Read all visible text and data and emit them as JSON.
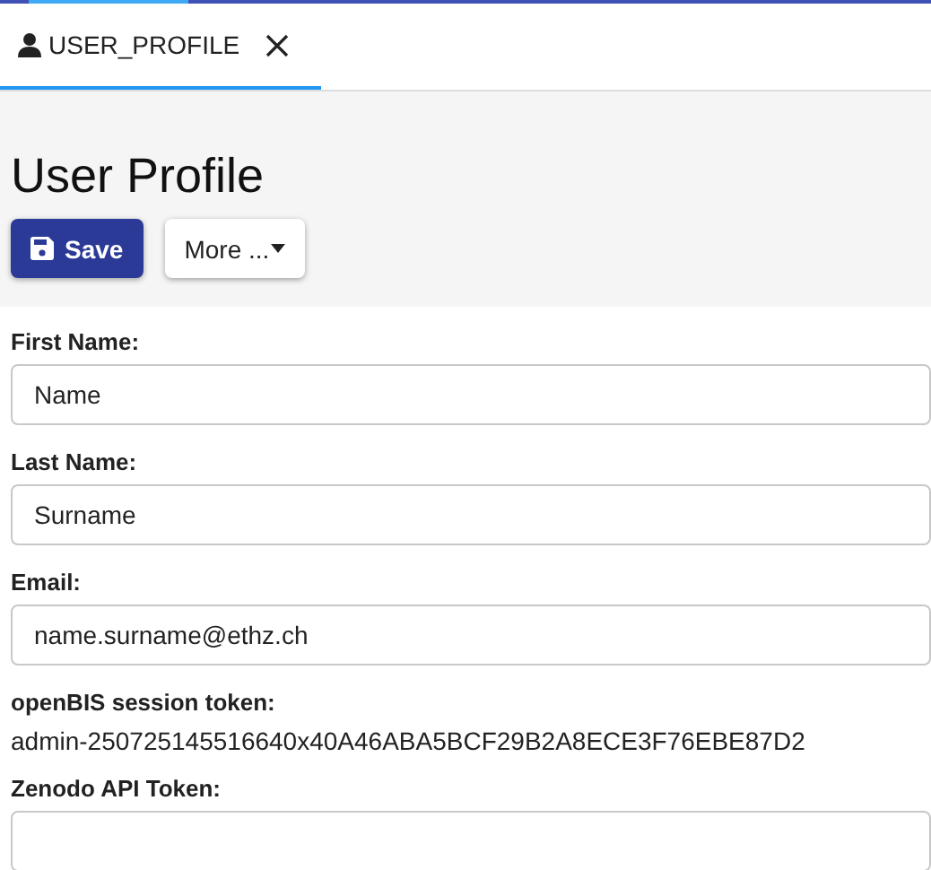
{
  "tabs": [
    {
      "label": "USER_PROFILE",
      "selected": true
    }
  ],
  "header": {
    "title": "User Profile",
    "buttons": [
      {
        "label": "Save",
        "kind": "primary"
      },
      {
        "label": "More ...",
        "kind": "dropdown"
      }
    ]
  },
  "fields": [
    {
      "label": "First Name:",
      "kind": "input",
      "value": "Name"
    },
    {
      "label": "Last Name:",
      "kind": "input",
      "value": "Surname"
    },
    {
      "label": "Email:",
      "kind": "input",
      "value": "name.surname@ethz.ch"
    },
    {
      "label": "openBIS session token:",
      "kind": "text",
      "value": "admin-250725145516640x40A46ABA5BCF29B2A8ECE3F76EBE87D2"
    },
    {
      "label": "Zenodo API Token:",
      "kind": "input"
    }
  ]
}
